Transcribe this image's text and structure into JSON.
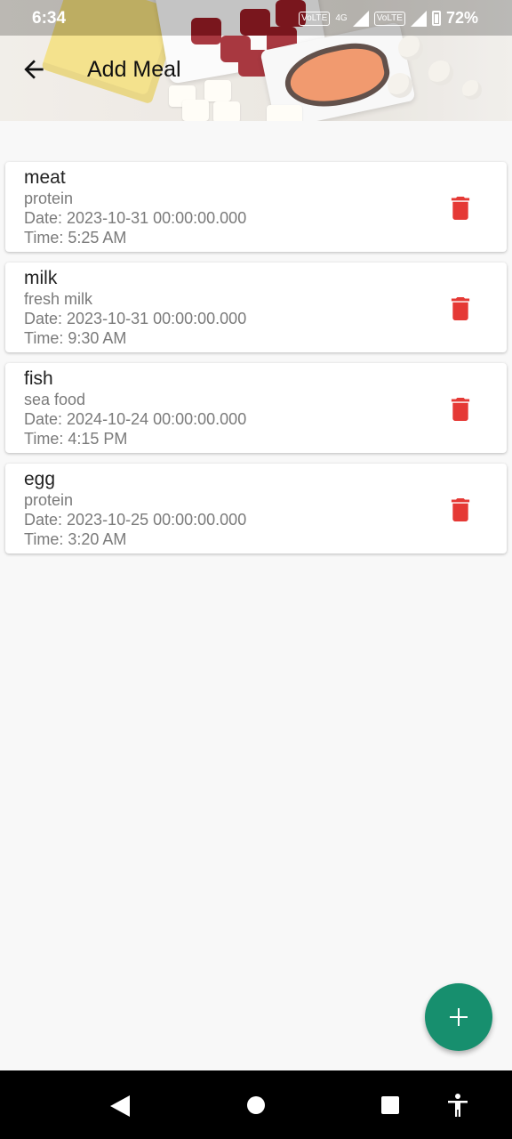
{
  "status_bar": {
    "time": "6:34",
    "volte1": "VoLTE",
    "volte2": "VoLTE",
    "network": "4G",
    "battery": "72%"
  },
  "app_bar": {
    "title": "Add Meal"
  },
  "meals": [
    {
      "name": "meat",
      "description": "protein",
      "date": "Date: 2023-10-31 00:00:00.000",
      "time": "Time: 5:25 AM"
    },
    {
      "name": "milk",
      "description": "fresh milk",
      "date": "Date: 2023-10-31 00:00:00.000",
      "time": "Time: 9:30 AM"
    },
    {
      "name": "fish",
      "description": "sea food",
      "date": "Date: 2024-10-24 00:00:00.000",
      "time": "Time: 4:15 PM"
    },
    {
      "name": "egg",
      "description": "protein",
      "date": "Date: 2023-10-25 00:00:00.000",
      "time": "Time: 3:20 AM"
    }
  ],
  "colors": {
    "delete": "#e53935",
    "fab": "#178f6e",
    "background": "#f8f8f8"
  },
  "icons": {
    "back": "arrow-back-icon",
    "delete": "trash-icon",
    "add": "plus-icon"
  }
}
